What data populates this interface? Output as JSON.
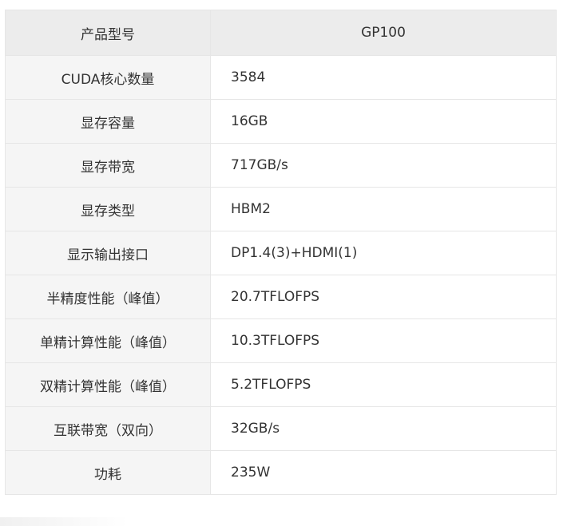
{
  "header": {
    "label": "产品型号",
    "value": "GP100"
  },
  "rows": [
    {
      "label": "CUDA核心数量",
      "value": "3584"
    },
    {
      "label": "显存容量",
      "value": "16GB"
    },
    {
      "label": "显存带宽",
      "value": "717GB/s"
    },
    {
      "label": "显存类型",
      "value": "HBM2"
    },
    {
      "label": "显示输出接口",
      "value": "DP1.4(3)+HDMI(1)"
    },
    {
      "label": "半精度性能（峰值）",
      "value": "20.7TFLOFPS"
    },
    {
      "label": "单精计算性能（峰值）",
      "value": "10.3TFLOFPS"
    },
    {
      "label": "双精计算性能（峰值）",
      "value": "5.2TFLOFPS"
    },
    {
      "label": "互联带宽（双向）",
      "value": "32GB/s"
    },
    {
      "label": "功耗",
      "value": "235W"
    }
  ]
}
